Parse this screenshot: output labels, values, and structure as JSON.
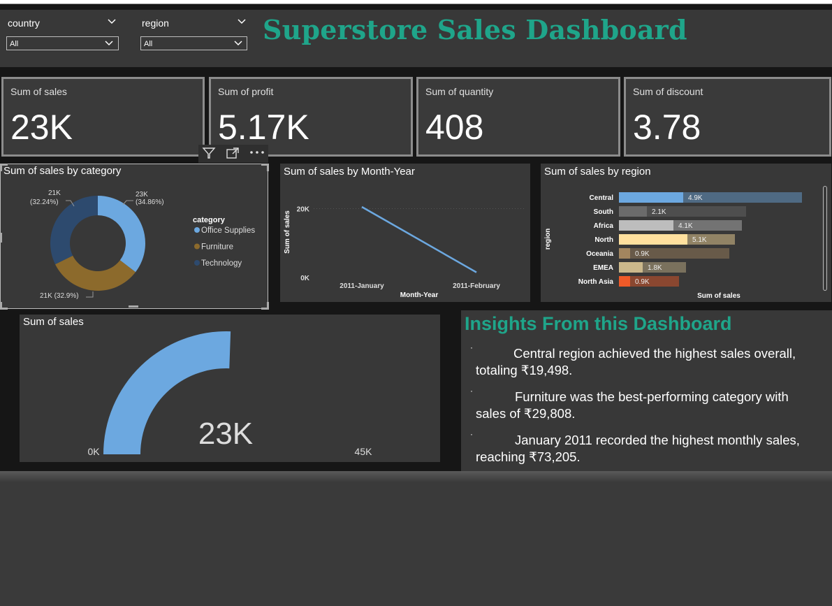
{
  "filters": {
    "country": {
      "label": "country",
      "value": "All"
    },
    "region": {
      "label": "region",
      "value": "All"
    }
  },
  "dashboard_title": "Superstore Sales Dashboard",
  "kpis": [
    {
      "label": "Sum of sales",
      "value": "23K"
    },
    {
      "label": "Sum of profit",
      "value": "5.17K"
    },
    {
      "label": "Sum of quantity",
      "value": "408"
    },
    {
      "label": "Sum of discount",
      "value": "3.78"
    }
  ],
  "colors": {
    "accent": "#1fa58a",
    "office_supplies": "#6ca8e0",
    "furniture": "#8c6a2c",
    "technology": "#2d4a6e"
  },
  "chart_data": [
    {
      "type": "pie",
      "title": "Sum of sales by category",
      "legend_title": "category",
      "legend_position": "right",
      "slices": [
        {
          "name": "Office Supplies",
          "value": 23000,
          "label": "23K",
          "pct": "(34.86%)",
          "color": "#6ca8e0"
        },
        {
          "name": "Furniture",
          "value": 21000,
          "label": "21K (32.9%)",
          "pct": "(32.9%)",
          "color": "#8c6a2c"
        },
        {
          "name": "Technology",
          "value": 21000,
          "label": "21K",
          "pct": "(32.24%)",
          "color": "#2d4a6e"
        }
      ]
    },
    {
      "type": "line",
      "title": "Sum of sales by Month-Year",
      "xlabel": "Month-Year",
      "ylabel": "Sum of sales",
      "categories": [
        "2011-January",
        "2011-February"
      ],
      "values": [
        20500,
        1500
      ],
      "yticks": [
        "0K",
        "20K"
      ],
      "ylim": [
        0,
        27000
      ],
      "color": "#6ca8e0"
    },
    {
      "type": "bar",
      "orientation": "horizontal",
      "title": "Sum of sales by region",
      "xlabel": "Sum of sales",
      "ylabel": "region",
      "categories": [
        "Central",
        "South",
        "Africa",
        "North",
        "Oceania",
        "EMEA",
        "North Asia"
      ],
      "values": [
        4.9,
        2.1,
        4.1,
        5.1,
        0.9,
        1.8,
        0.9
      ],
      "labels": [
        "4.9K",
        "2.1K",
        "4.1K",
        "5.1K",
        "0.9K",
        "1.8K",
        "0.9K"
      ],
      "colors": [
        "#6ca8e0",
        "#6b6b6b",
        "#bdbdbd",
        "#ffe09e",
        "#a3865f",
        "#cbb88b",
        "#f05a28"
      ]
    },
    {
      "type": "gauge",
      "title": "Sum of sales",
      "value": 23,
      "value_label": "23K",
      "min_label": "0K",
      "max_label": "45K",
      "min": 0,
      "max": 45,
      "color": "#6ca8e0"
    }
  ],
  "insights": {
    "title": "Insights From this Dashboard",
    "bullet": "·",
    "items": [
      {
        "lead": "Central region achieved the highest sales overall,",
        "rest": "totaling ₹19,498."
      },
      {
        "lead": "Furniture was the best-performing category with",
        "rest": "sales of ₹29,808."
      },
      {
        "lead": "January 2011 recorded the highest monthly sales,",
        "rest": "reaching ₹73,205."
      }
    ]
  }
}
